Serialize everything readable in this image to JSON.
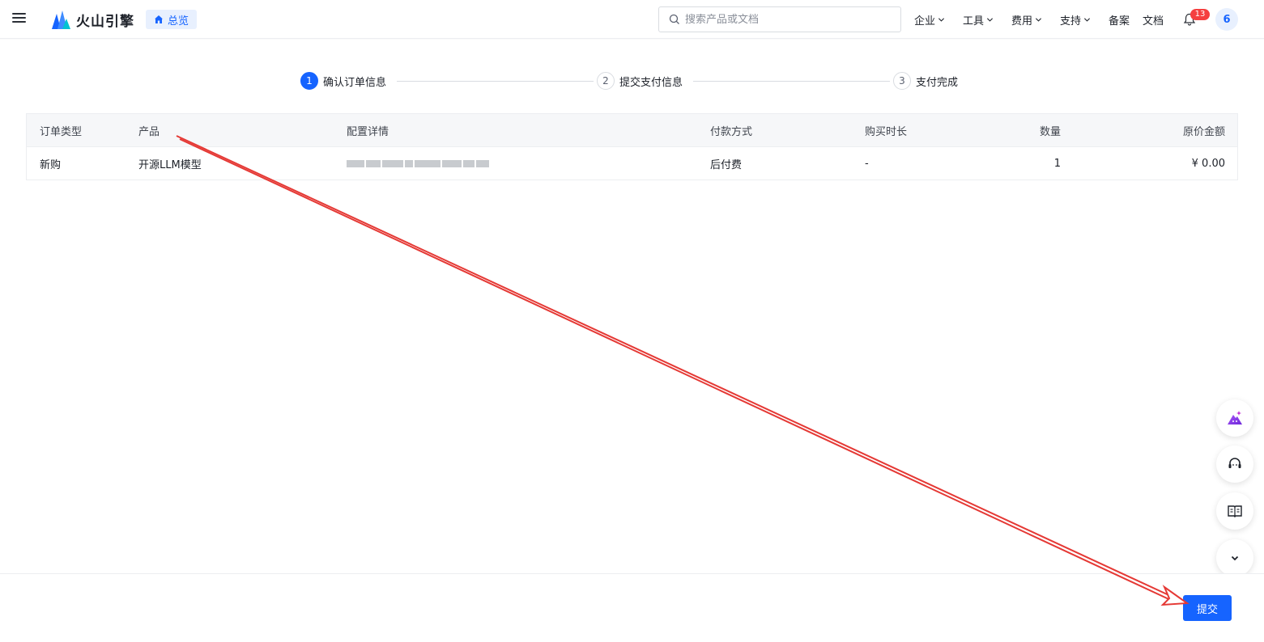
{
  "header": {
    "brand": "火山引擎",
    "overview_label": "总览",
    "search_placeholder": "搜索产品或文档",
    "nav": {
      "enterprise": "企业",
      "tools": "工具",
      "billing": "费用",
      "support": "支持",
      "filing": "备案",
      "docs": "文档"
    },
    "notification_count": "13",
    "avatar_text": "6"
  },
  "steps": [
    {
      "num": "1",
      "label": "确认订单信息",
      "active": true
    },
    {
      "num": "2",
      "label": "提交支付信息",
      "active": false
    },
    {
      "num": "3",
      "label": "支付完成",
      "active": false
    }
  ],
  "table": {
    "headers": {
      "order_type": "订单类型",
      "product": "产品",
      "config": "配置详情",
      "payment": "付款方式",
      "duration": "购买时长",
      "quantity": "数量",
      "price": "原价金额"
    },
    "rows": [
      {
        "order_type": "新购",
        "product": "开源LLM模型",
        "payment": "后付费",
        "duration": "-",
        "quantity": "1",
        "price": "¥ 0.00"
      }
    ]
  },
  "footer": {
    "submit_label": "提交"
  },
  "colors": {
    "primary": "#1664ff",
    "badge": "#f53f3f",
    "annotation_arrow": "#e53935"
  },
  "icons": {
    "menu": "hamburger-menu-icon",
    "home": "home-icon",
    "search": "search-icon",
    "chevron": "chevron-down-icon",
    "bell": "bell-icon",
    "ai_assistant": "ai-assistant-icon",
    "support": "headset-icon",
    "docs": "book-icon",
    "collapse": "chevron-down-icon"
  }
}
